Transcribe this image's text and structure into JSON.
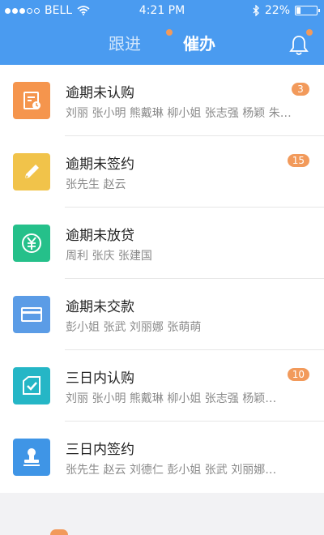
{
  "status_bar": {
    "carrier": "BELL",
    "time": "4:21 PM",
    "battery_text": "22%",
    "battery_level": 0.22
  },
  "tabs": [
    {
      "label": "跟进"
    },
    {
      "label": "催办"
    }
  ],
  "items": [
    {
      "title": "逾期未认购",
      "names": "刘丽 张小明 熊戴琳 柳小姐 张志强 杨颖 朱…",
      "badge": "3",
      "icon": "calendar-clock-icon",
      "color": "#f5954d"
    },
    {
      "title": "逾期未签约",
      "names": "张先生 赵云",
      "badge": "15",
      "icon": "pencil-icon",
      "color": "#f1c34a"
    },
    {
      "title": "逾期未放贷",
      "names": "周利 张庆 张建国",
      "badge": "",
      "icon": "yuan-icon",
      "color": "#25c08a"
    },
    {
      "title": "逾期未交款",
      "names": "彭小姐 张武 刘丽娜 张萌萌",
      "badge": "",
      "icon": "card-icon",
      "color": "#5b9ce6"
    },
    {
      "title": "三日内认购",
      "names": "刘丽 张小明 熊戴琳 柳小姐 张志强 杨颖…",
      "badge": "10",
      "icon": "checkbox-icon",
      "color": "#25b6c6"
    },
    {
      "title": "三日内签约",
      "names": "张先生 赵云 刘德仁 彭小姐 张武 刘丽娜…",
      "badge": "",
      "icon": "stamp-icon",
      "color": "#3f95e6"
    }
  ]
}
